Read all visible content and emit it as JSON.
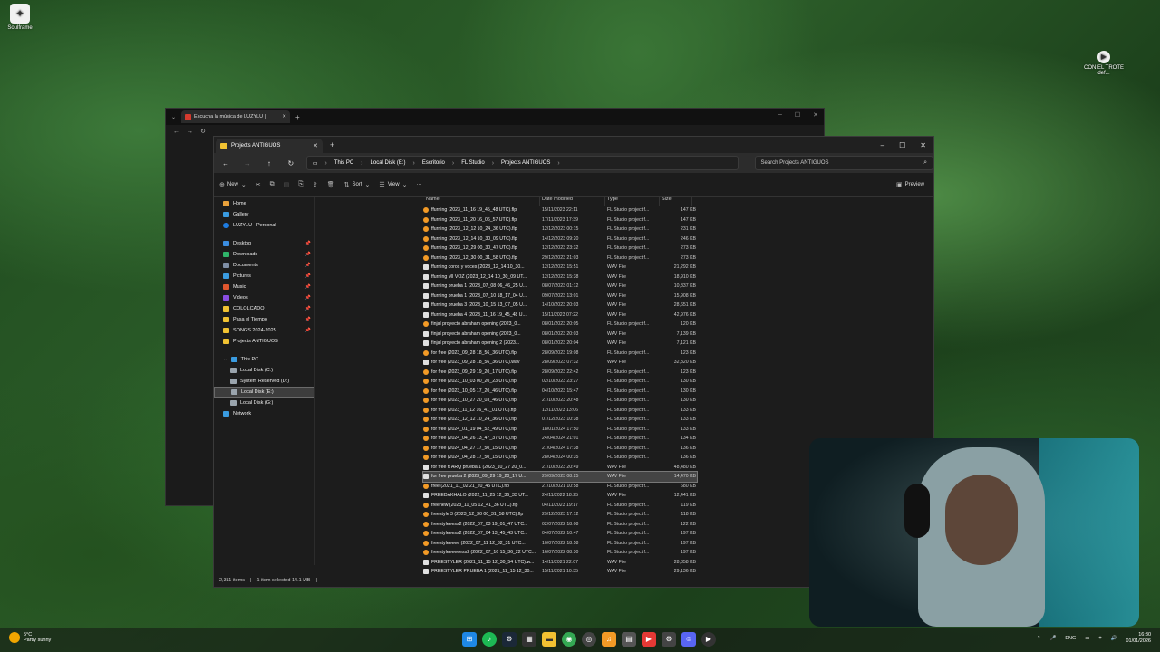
{
  "desktop": {
    "icon_top_left": "Soulframe",
    "icon_top_right": "CON EL TROTE def..."
  },
  "bg_browser": {
    "tab_title": "Escucha la música de LUZYLU |",
    "close": "✕",
    "plus": "+"
  },
  "explorer": {
    "tab_title": "Projects ANTIGUOS",
    "breadcrumbs": [
      "This PC",
      "Local Disk (E:)",
      "Escritorio",
      "FL Studio",
      "Projects ANTIGUOS"
    ],
    "search_placeholder": "Search Projects ANTIGUOS",
    "toolbar": {
      "new": "New",
      "sort": "Sort",
      "view": "View",
      "more": "···",
      "preview": "Preview"
    },
    "nav": {
      "home": "Home",
      "gallery": "Gallery",
      "personal": "LUZYLU - Personal",
      "desktop": "Desktop",
      "downloads": "Downloads",
      "documents": "Documents",
      "pictures": "Pictures",
      "music": "Music",
      "videos": "Videos",
      "colocado": "COLOLCADO",
      "pasa": "Pasa el Tiempo",
      "songs": "SONGS 2024-2025",
      "projects": "Projects ANTIGUOS",
      "thispc": "This PC",
      "diskc": "Local Disk (C:)",
      "reserved": "System Reserved (D:)",
      "diske": "Local Disk (E:)",
      "diskg": "Local Disk (G:)",
      "network": "Network"
    },
    "columns": {
      "name": "Name",
      "date": "Date modified",
      "type": "Type",
      "size": "Size"
    },
    "files": [
      {
        "n": "ffurning (2023_11_16 19_45_48 UTC).flp",
        "d": "15/11/2023 22:11",
        "t": "FL Studio project f...",
        "s": "147 KB",
        "k": "flp"
      },
      {
        "n": "ffurning (2023_11_20 16_06_57 UTC).flp",
        "d": "17/11/2023 17:39",
        "t": "FL Studio project f...",
        "s": "147 KB",
        "k": "flp"
      },
      {
        "n": "ffurning (2023_12_12 10_24_36 UTC).flp",
        "d": "12/12/2023 00:15",
        "t": "FL Studio project f...",
        "s": "231 KB",
        "k": "flp"
      },
      {
        "n": "ffurning (2023_12_14 10_30_09 UTC).flp",
        "d": "14/12/2023 09:20",
        "t": "FL Studio project f...",
        "s": "246 KB",
        "k": "flp"
      },
      {
        "n": "ffurning (2023_12_29 00_30_47 UTC).flp",
        "d": "12/12/2023 23:32",
        "t": "FL Studio project f...",
        "s": "273 KB",
        "k": "flp"
      },
      {
        "n": "ffurning (2023_12_30 00_31_58 UTC).flp",
        "d": "29/12/2023 21:03",
        "t": "FL Studio project f...",
        "s": "273 KB",
        "k": "flp"
      },
      {
        "n": "ffurning coros y voces (2023_12_14 10_30...",
        "d": "12/12/2023 15:51",
        "t": "WAV File",
        "s": "21,292 KB",
        "k": "wav"
      },
      {
        "n": "ffurning MI VOZ (2023_12_14 10_30_09 UT...",
        "d": "12/12/2023 15:38",
        "t": "WAV File",
        "s": "18,910 KB",
        "k": "wav"
      },
      {
        "n": "ffurning prueba 1 (2023_07_08 06_46_25 U...",
        "d": "08/07/2023 01:12",
        "t": "WAV File",
        "s": "10,837 KB",
        "k": "wav"
      },
      {
        "n": "ffurning prueba 1 (2023_07_10 18_17_04 U...",
        "d": "09/07/2023 13:01",
        "t": "WAV File",
        "s": "15,908 KB",
        "k": "wav"
      },
      {
        "n": "ffurning prueba 3 (2023_10_15 13_07_05 U...",
        "d": "14/10/2023 20:03",
        "t": "WAV File",
        "s": "28,651 KB",
        "k": "wav"
      },
      {
        "n": "ffurning prueba 4 (2023_11_16 19_45_48 U...",
        "d": "15/11/2023 07:22",
        "t": "WAV File",
        "s": "42,976 KB",
        "k": "wav"
      },
      {
        "n": "finjal proyecto abraham opening (2023_0...",
        "d": "08/01/2023 20:05",
        "t": "FL Studio project f...",
        "s": "120 KB",
        "k": "flp"
      },
      {
        "n": "finjal proyecto abraham opening (2023_0...",
        "d": "08/01/2023 20:03",
        "t": "WAV File",
        "s": "7,139 KB",
        "k": "wav"
      },
      {
        "n": "finjal proyecto abraham opening 2 (2023...",
        "d": "08/01/2023 20:04",
        "t": "WAV File",
        "s": "7,121 KB",
        "k": "wav"
      },
      {
        "n": "for free (2023_09_28 18_56_36 UTC).flp",
        "d": "28/09/2023 19:08",
        "t": "FL Studio project f...",
        "s": "123 KB",
        "k": "flp"
      },
      {
        "n": "for free (2023_09_28 18_56_36 UTC).wav",
        "d": "28/09/2023 07:32",
        "t": "WAV File",
        "s": "32,320 KB",
        "k": "wav"
      },
      {
        "n": "for free (2023_09_29 19_20_17 UTC).flp",
        "d": "28/09/2023 22:42",
        "t": "FL Studio project f...",
        "s": "123 KB",
        "k": "flp"
      },
      {
        "n": "for free (2023_10_03 00_20_23 UTC).flp",
        "d": "02/10/2023 23:27",
        "t": "FL Studio project f...",
        "s": "130 KB",
        "k": "flp"
      },
      {
        "n": "for free (2023_10_05 17_20_46 UTC).flp",
        "d": "04/10/2023 15:47",
        "t": "FL Studio project f...",
        "s": "130 KB",
        "k": "flp"
      },
      {
        "n": "for free (2023_10_27 20_03_46 UTC).flp",
        "d": "27/10/2023 20:48",
        "t": "FL Studio project f...",
        "s": "130 KB",
        "k": "flp"
      },
      {
        "n": "for free (2023_11_12 16_41_01 UTC).flp",
        "d": "12/11/2023 13:06",
        "t": "FL Studio project f...",
        "s": "133 KB",
        "k": "flp"
      },
      {
        "n": "for free (2023_12_12 10_24_36 UTC).flp",
        "d": "07/12/2023 10:38",
        "t": "FL Studio project f...",
        "s": "133 KB",
        "k": "flp"
      },
      {
        "n": "for free (2024_01_19 04_52_49 UTC).flp",
        "d": "18/01/2024 17:50",
        "t": "FL Studio project f...",
        "s": "133 KB",
        "k": "flp"
      },
      {
        "n": "for free (2024_04_26 13_47_37 UTC).flp",
        "d": "24/04/2024 21:01",
        "t": "FL Studio project f...",
        "s": "134 KB",
        "k": "flp"
      },
      {
        "n": "for free (2024_04_27 17_50_15 UTC).flp",
        "d": "27/04/2024 17:38",
        "t": "FL Studio project f...",
        "s": "136 KB",
        "k": "flp"
      },
      {
        "n": "for free (2024_04_28 17_50_15 UTC).flp",
        "d": "28/04/2024 00:35",
        "t": "FL Studio project f...",
        "s": "136 KB",
        "k": "flp"
      },
      {
        "n": "for free ft ARQ prueba 1 (2023_10_27 20_0...",
        "d": "27/10/2023 20:49",
        "t": "WAV File",
        "s": "48,480 KB",
        "k": "wav"
      },
      {
        "n": "for free prueba 2 (2023_09_29 19_20_17 U...",
        "d": "29/09/2023 08:25",
        "t": "WAV File",
        "s": "14,470 KB",
        "k": "wav",
        "sel": true
      },
      {
        "n": "free (2021_11_02 21_20_45 UTC).flp",
        "d": "27/10/2021 10:58",
        "t": "FL Studio project f...",
        "s": "680 KB",
        "k": "flp"
      },
      {
        "n": "FREEDAKHALO (2022_11_25 12_36_33 UT...",
        "d": "24/11/2022 18:25",
        "t": "WAV File",
        "s": "12,441 KB",
        "k": "wav"
      },
      {
        "n": "freenew (2023_11_05 12_41_36 UTC).flp",
        "d": "04/11/2023 19:17",
        "t": "FL Studio project f...",
        "s": "119 KB",
        "k": "flp"
      },
      {
        "n": "freestyle 3 (2023_12_30 00_31_58 UTC).flp",
        "d": "29/12/2023 17:12",
        "t": "FL Studio project f...",
        "s": "118 KB",
        "k": "flp"
      },
      {
        "n": "freestyleeess2 (2022_07_03 19_01_47 UTC...",
        "d": "02/07/2022 18:08",
        "t": "FL Studio project f...",
        "s": "122 KB",
        "k": "flp"
      },
      {
        "n": "freestyleeess2 (2022_07_04 13_45_43 UTC...",
        "d": "04/07/2022 10:47",
        "t": "FL Studio project f...",
        "s": "197 KB",
        "k": "flp"
      },
      {
        "n": "freestyleeeee (2022_07_11 12_32_31 UTC...",
        "d": "10/07/2022 18:58",
        "t": "FL Studio project f...",
        "s": "197 KB",
        "k": "flp"
      },
      {
        "n": "freestyleeeeeess2 (2022_07_16 15_36_22 UTC...",
        "d": "16/07/2022 08:30",
        "t": "FL Studio project f...",
        "s": "197 KB",
        "k": "flp"
      },
      {
        "n": "FREESTYLER (2021_11_15 12_30_54 UTC).w...",
        "d": "14/11/2021 22:07",
        "t": "WAV File",
        "s": "28,858 KB",
        "k": "wav"
      },
      {
        "n": "FREESTYLER PRUEBA 1 (2021_11_15 12_30...",
        "d": "15/11/2021 10:35",
        "t": "WAV File",
        "s": "29,136 KB",
        "k": "wav"
      }
    ],
    "status": {
      "items": "2,311 items",
      "selected": "1 item selected  14.1 MB"
    }
  },
  "taskbar": {
    "weather_temp": "5°C",
    "weather_desc": "Partly sunny",
    "lang": "ENG",
    "time": "16:30",
    "date": "01/01/2026"
  }
}
